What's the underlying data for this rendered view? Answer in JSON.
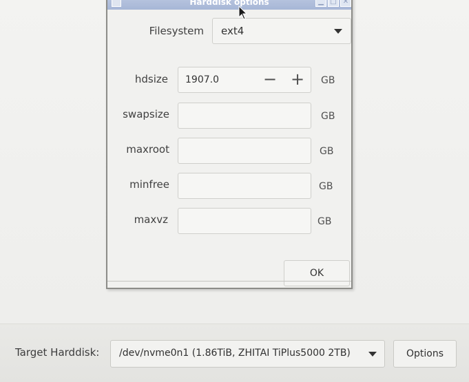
{
  "dialog": {
    "title": "Harddisk options",
    "filesystem": {
      "label": "Filesystem",
      "value": "ext4"
    },
    "fields": [
      {
        "label": "hdsize",
        "value": "1907.0",
        "unit": "GB"
      },
      {
        "label": "swapsize",
        "value": "",
        "unit": "GB"
      },
      {
        "label": "maxroot",
        "value": "",
        "unit": "GB"
      },
      {
        "label": "minfree",
        "value": "",
        "unit": "GB"
      },
      {
        "label": "maxvz",
        "value": "",
        "unit": "GB"
      }
    ],
    "spin_minus": "−",
    "spin_plus": "+",
    "ok_label": "OK"
  },
  "main": {
    "target_label": "Target Harddisk:",
    "target_value": "/dev/nvme0n1 (1.86TiB, ZHITAI TiPlus5000 2TB)",
    "options_label": "Options"
  },
  "icons": {
    "dropdown": "chevron-down-icon",
    "cursor": "mouse-pointer-icon"
  }
}
